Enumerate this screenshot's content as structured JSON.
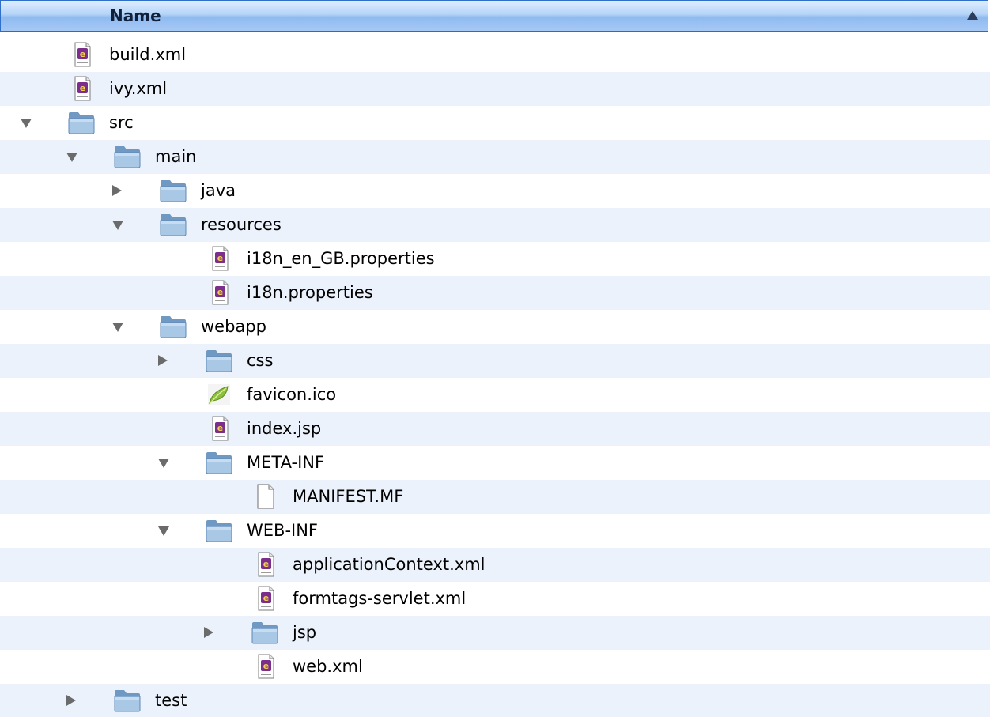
{
  "header": {
    "name_label": "Name",
    "sort_direction": "ascending"
  },
  "colors": {
    "row_alt": "#ebf2fc",
    "header_blue": "#a6c9f5",
    "folder_blue": "#8fb5d8",
    "xml_purple": "#7b2e8c",
    "favicon_green": "#8cbf3a"
  },
  "rows": [
    {
      "label": "build.xml",
      "depth": 0,
      "kind": "xml-file",
      "icon": "xml-file-icon",
      "expander": "none"
    },
    {
      "label": "ivy.xml",
      "depth": 0,
      "kind": "xml-file",
      "icon": "xml-file-icon",
      "expander": "none"
    },
    {
      "label": "src",
      "depth": 0,
      "kind": "folder",
      "icon": "folder-icon",
      "expander": "expanded"
    },
    {
      "label": "main",
      "depth": 1,
      "kind": "folder",
      "icon": "folder-icon",
      "expander": "expanded"
    },
    {
      "label": "java",
      "depth": 2,
      "kind": "folder",
      "icon": "folder-icon",
      "expander": "collapsed"
    },
    {
      "label": "resources",
      "depth": 2,
      "kind": "folder",
      "icon": "folder-icon",
      "expander": "expanded"
    },
    {
      "label": "i18n_en_GB.properties",
      "depth": 3,
      "kind": "xml-file",
      "icon": "properties-file-icon",
      "expander": "none"
    },
    {
      "label": "i18n.properties",
      "depth": 3,
      "kind": "xml-file",
      "icon": "properties-file-icon",
      "expander": "none"
    },
    {
      "label": "webapp",
      "depth": 2,
      "kind": "folder",
      "icon": "folder-icon",
      "expander": "expanded"
    },
    {
      "label": "css",
      "depth": 3,
      "kind": "folder",
      "icon": "folder-icon",
      "expander": "collapsed"
    },
    {
      "label": "favicon.ico",
      "depth": 3,
      "kind": "ico-file",
      "icon": "favicon-leaf-icon",
      "expander": "none"
    },
    {
      "label": "index.jsp",
      "depth": 3,
      "kind": "xml-file",
      "icon": "jsp-file-icon",
      "expander": "none"
    },
    {
      "label": "META-INF",
      "depth": 3,
      "kind": "folder",
      "icon": "folder-icon",
      "expander": "expanded"
    },
    {
      "label": "MANIFEST.MF",
      "depth": 4,
      "kind": "plain-file",
      "icon": "plain-document-icon",
      "expander": "none"
    },
    {
      "label": "WEB-INF",
      "depth": 3,
      "kind": "folder",
      "icon": "folder-icon",
      "expander": "expanded"
    },
    {
      "label": "applicationContext.xml",
      "depth": 4,
      "kind": "xml-file",
      "icon": "xml-file-icon",
      "expander": "none"
    },
    {
      "label": "formtags-servlet.xml",
      "depth": 4,
      "kind": "xml-file",
      "icon": "xml-file-icon",
      "expander": "none"
    },
    {
      "label": "jsp",
      "depth": 4,
      "kind": "folder",
      "icon": "folder-icon",
      "expander": "collapsed"
    },
    {
      "label": "web.xml",
      "depth": 4,
      "kind": "xml-file",
      "icon": "xml-file-icon",
      "expander": "none"
    },
    {
      "label": "test",
      "depth": 1,
      "kind": "folder",
      "icon": "folder-icon",
      "expander": "collapsed"
    }
  ]
}
